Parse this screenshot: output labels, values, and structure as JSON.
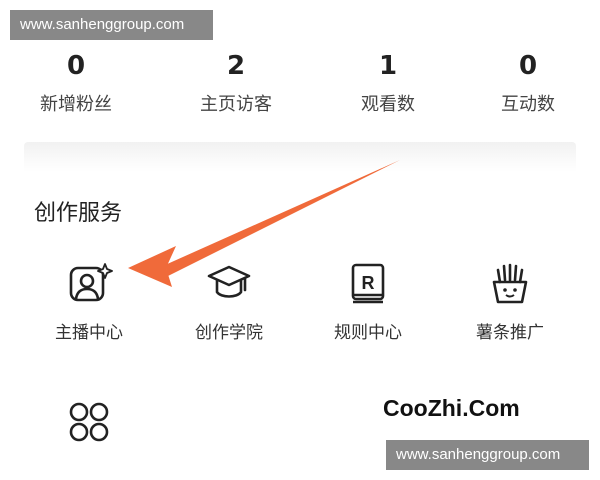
{
  "watermark": {
    "top_text": "www.sanhenggroup.com",
    "bottom_text": "www.sanhenggroup.com"
  },
  "stats": [
    {
      "value": "0",
      "label": "新增粉丝"
    },
    {
      "value": "2",
      "label": "主页访客"
    },
    {
      "value": "1",
      "label": "观看数"
    },
    {
      "value": "0",
      "label": "互动数"
    }
  ],
  "section": {
    "title": "创作服务"
  },
  "services": [
    {
      "label": "主播中心",
      "icon": "host-center-icon"
    },
    {
      "label": "创作学院",
      "icon": "graduation-cap-icon"
    },
    {
      "label": "规则中心",
      "icon": "rules-book-icon"
    },
    {
      "label": "薯条推广",
      "icon": "fries-promotion-icon"
    }
  ],
  "more": {
    "icon": "four-circles-icon"
  },
  "brand": {
    "text": "CooZhi.Com"
  },
  "colors": {
    "arrow": "#f06a3a",
    "text": "#222222",
    "watermark_bg": "#6e6e6e"
  }
}
